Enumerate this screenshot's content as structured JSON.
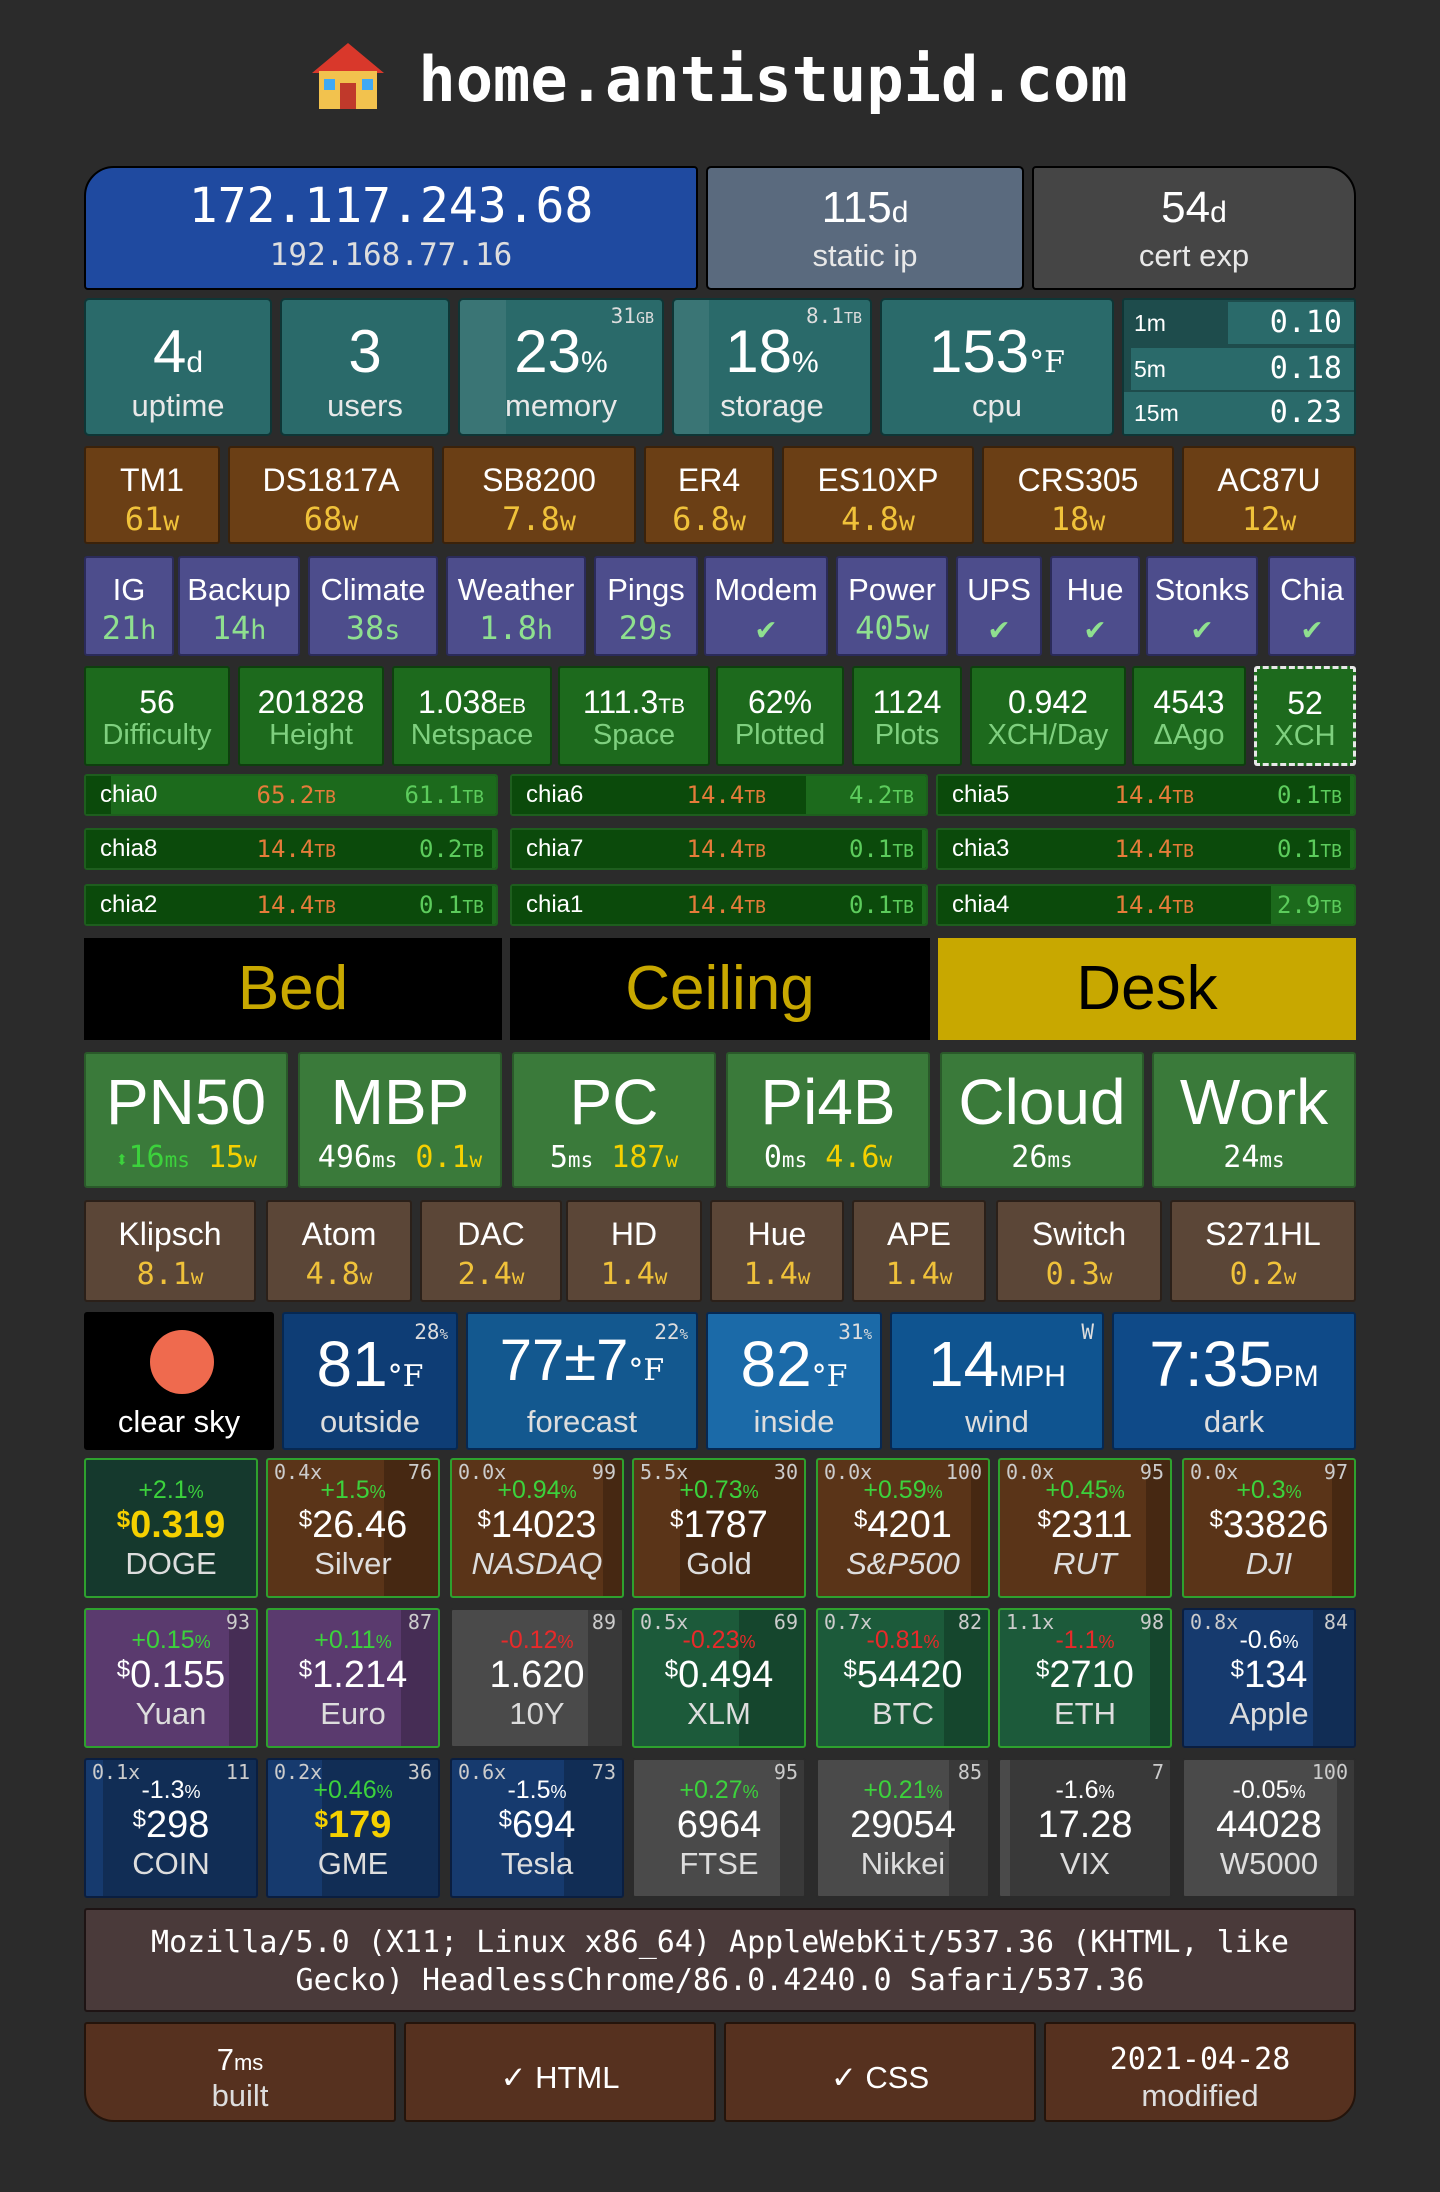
{
  "site": {
    "title": "home.antistupid.com",
    "icon": "house-icon"
  },
  "net": {
    "public_ip": "172.117.243.68",
    "local_ip": "192.168.77.16",
    "static_val": "115",
    "static_unit": "d",
    "static_lbl": "static ip",
    "cert_val": "54",
    "cert_unit": "d",
    "cert_lbl": "cert exp"
  },
  "sys": {
    "uptime_val": "4",
    "uptime_unit": "d",
    "uptime_lbl": "uptime",
    "users_val": "3",
    "users_lbl": "users",
    "mem_val": "23",
    "mem_unit": "%",
    "mem_cap": "31",
    "mem_cap_unit": "GB",
    "mem_lbl": "memory",
    "sto_val": "18",
    "sto_unit": "%",
    "sto_cap": "8.1",
    "sto_cap_unit": "TB",
    "sto_lbl": "storage",
    "cpu_val": "153",
    "cpu_unit": "°F",
    "cpu_lbl": "cpu",
    "load": [
      {
        "name": "1m",
        "value": "0.10",
        "frac": 0.55
      },
      {
        "name": "5m",
        "value": "0.18",
        "frac": 0.97
      },
      {
        "name": "15m",
        "value": "0.23",
        "frac": 1.0
      }
    ]
  },
  "devices": [
    {
      "name": "TM1",
      "val": "61",
      "unit": "w"
    },
    {
      "name": "DS1817A",
      "val": "68",
      "unit": "w"
    },
    {
      "name": "SB8200",
      "val": "7.8",
      "unit": "w"
    },
    {
      "name": "ER4",
      "val": "6.8",
      "unit": "w"
    },
    {
      "name": "ES10XP",
      "val": "4.8",
      "unit": "w"
    },
    {
      "name": "CRS305",
      "val": "18",
      "unit": "w"
    },
    {
      "name": "AC87U",
      "val": "12",
      "unit": "w"
    }
  ],
  "jobs": [
    {
      "name": "IG",
      "val": "21",
      "unit": "h"
    },
    {
      "name": "Backup",
      "val": "14",
      "unit": "h"
    },
    {
      "name": "Climate",
      "val": "38",
      "unit": "s"
    },
    {
      "name": "Weather",
      "val": "1.8",
      "unit": "h"
    },
    {
      "name": "Pings",
      "val": "29",
      "unit": "s"
    },
    {
      "name": "Modem",
      "val": "✔",
      "unit": ""
    },
    {
      "name": "Power",
      "val": "405",
      "unit": "w"
    },
    {
      "name": "UPS",
      "val": "✔",
      "unit": ""
    },
    {
      "name": "Hue",
      "val": "✔",
      "unit": ""
    },
    {
      "name": "Stonks",
      "val": "✔",
      "unit": ""
    },
    {
      "name": "Chia",
      "val": "✔",
      "unit": ""
    }
  ],
  "chia": [
    {
      "val": "56",
      "unit": "",
      "lbl": "Difficulty"
    },
    {
      "val": "201828",
      "unit": "",
      "lbl": "Height"
    },
    {
      "val": "1.038",
      "unit": "EB",
      "lbl": "Netspace"
    },
    {
      "val": "111.3",
      "unit": "TB",
      "lbl": "Space"
    },
    {
      "val": "62%",
      "unit": "",
      "lbl": "Plotted"
    },
    {
      "val": "1124",
      "unit": "",
      "lbl": "Plots"
    },
    {
      "val": "0.942",
      "unit": "",
      "lbl": "XCH/Day"
    },
    {
      "val": "4543",
      "unit": "",
      "lbl": "ΔAgo"
    },
    {
      "val": "52",
      "unit": "",
      "lbl": "XCH"
    }
  ],
  "disks": [
    {
      "name": "chia0",
      "total": "65.2",
      "tu": "TB",
      "free": "61.1",
      "fu": "TB",
      "used": 0.06
    },
    {
      "name": "chia6",
      "total": "14.4",
      "tu": "TB",
      "free": "4.2",
      "fu": "TB",
      "used": 0.71
    },
    {
      "name": "chia5",
      "total": "14.4",
      "tu": "TB",
      "free": "0.1",
      "fu": "TB",
      "used": 0.99
    },
    {
      "name": "chia8",
      "total": "14.4",
      "tu": "TB",
      "free": "0.2",
      "fu": "TB",
      "used": 0.99
    },
    {
      "name": "chia7",
      "total": "14.4",
      "tu": "TB",
      "free": "0.1",
      "fu": "TB",
      "used": 0.99
    },
    {
      "name": "chia3",
      "total": "14.4",
      "tu": "TB",
      "free": "0.1",
      "fu": "TB",
      "used": 0.99
    },
    {
      "name": "chia2",
      "total": "14.4",
      "tu": "TB",
      "free": "0.1",
      "fu": "TB",
      "used": 0.99
    },
    {
      "name": "chia1",
      "total": "14.4",
      "tu": "TB",
      "free": "0.1",
      "fu": "TB",
      "used": 0.99
    },
    {
      "name": "chia4",
      "total": "14.4",
      "tu": "TB",
      "free": "2.9",
      "fu": "TB",
      "used": 0.8
    }
  ],
  "lights": [
    {
      "name": "Bed",
      "on": false
    },
    {
      "name": "Ceiling",
      "on": false
    },
    {
      "name": "Desk",
      "on": true
    }
  ],
  "hosts": [
    {
      "name": "PN50",
      "ping": "16",
      "pu": "ms",
      "watt": "15",
      "wu": "w",
      "prefix": "⬍"
    },
    {
      "name": "MBP",
      "ping": "496",
      "pu": "ms",
      "watt": "0.1",
      "wu": "w",
      "prefix": ""
    },
    {
      "name": "PC",
      "ping": "5",
      "pu": "ms",
      "watt": "187",
      "wu": "w",
      "prefix": ""
    },
    {
      "name": "Pi4B",
      "ping": "0",
      "pu": "ms",
      "watt": "4.6",
      "wu": "w",
      "prefix": ""
    },
    {
      "name": "Cloud",
      "ping": "26",
      "pu": "ms",
      "watt": "",
      "wu": "",
      "prefix": ""
    },
    {
      "name": "Work",
      "ping": "24",
      "pu": "ms",
      "watt": "",
      "wu": "",
      "prefix": ""
    }
  ],
  "power": [
    {
      "name": "Klipsch",
      "val": "8.1",
      "unit": "w"
    },
    {
      "name": "Atom",
      "val": "4.8",
      "unit": "w"
    },
    {
      "name": "DAC",
      "val": "2.4",
      "unit": "w"
    },
    {
      "name": "HD",
      "val": "1.4",
      "unit": "w"
    },
    {
      "name": "Hue",
      "val": "1.4",
      "unit": "w"
    },
    {
      "name": "APE",
      "val": "1.4",
      "unit": "w"
    },
    {
      "name": "Switch",
      "val": "0.3",
      "unit": "w"
    },
    {
      "name": "S271HL",
      "val": "0.2",
      "unit": "w"
    }
  ],
  "weather": {
    "sky": "clear sky",
    "sky_icon": "sun-icon",
    "outside_val": "81",
    "outside_unit": "°F",
    "outside_lbl": "outside",
    "outside_cap": "28",
    "fc_val": "77±7",
    "fc_unit": "°F",
    "fc_lbl": "forecast",
    "fc_cap": "22",
    "in_val": "82",
    "in_unit": "°F",
    "in_lbl": "inside",
    "in_cap": "31",
    "wind_val": "14",
    "wind_unit": "MPH",
    "wind_lbl": "wind",
    "wind_cap": "W",
    "time_val": "7:35",
    "time_unit": "PM",
    "time_lbl": "dark",
    "pct": "%"
  },
  "stocks": [
    [
      {
        "tl": "",
        "tr": "",
        "chg": "+2.1",
        "price": "0.319",
        "cur": "$",
        "name": "DOGE",
        "bg": "#1c4a3a",
        "hl": true,
        "pos": true,
        "it": false
      },
      {
        "tl": "0.4x",
        "tr": "76",
        "chg": "+1.5",
        "price": "26.46",
        "cur": "$",
        "name": "Silver",
        "bg": "#5a3418",
        "hl": false,
        "pos": true,
        "it": false
      },
      {
        "tl": "0.0x",
        "tr": "99",
        "chg": "+0.94",
        "price": "14023",
        "cur": "$",
        "name": "NASDAQ",
        "bg": "#5a3418",
        "hl": false,
        "pos": true,
        "it": true
      },
      {
        "tl": "5.5x",
        "tr": "30",
        "chg": "+0.73",
        "price": "1787",
        "cur": "$",
        "name": "Gold",
        "bg": "#5a3418",
        "hl": false,
        "pos": true,
        "it": false
      },
      {
        "tl": "0.0x",
        "tr": "100",
        "chg": "+0.59",
        "price": "4201",
        "cur": "$",
        "name": "S&P500",
        "bg": "#5a3418",
        "hl": false,
        "pos": true,
        "it": true
      },
      {
        "tl": "0.0x",
        "tr": "95",
        "chg": "+0.45",
        "price": "2311",
        "cur": "$",
        "name": "RUT",
        "bg": "#5a3418",
        "hl": false,
        "pos": true,
        "it": true
      },
      {
        "tl": "0.0x",
        "tr": "97",
        "chg": "+0.3",
        "price": "33826",
        "cur": "$",
        "name": "DJI",
        "bg": "#5a3418",
        "hl": false,
        "pos": true,
        "it": true
      }
    ],
    [
      {
        "tl": "",
        "tr": "93",
        "chg": "+0.15",
        "price": "0.155",
        "cur": "$",
        "name": "Yuan",
        "bg": "#5a3a6e",
        "hl": false,
        "pos": true,
        "it": false
      },
      {
        "tl": "",
        "tr": "87",
        "chg": "+0.11",
        "price": "1.214",
        "cur": "$",
        "name": "Euro",
        "bg": "#5a3a6e",
        "hl": false,
        "pos": true,
        "it": false
      },
      {
        "tl": "",
        "tr": "89",
        "chg": "-0.12",
        "price": "1.620",
        "cur": "",
        "name": "10Y",
        "bg": "#4a4a4a",
        "hl": false,
        "pos": false,
        "it": false
      },
      {
        "tl": "0.5x",
        "tr": "69",
        "chg": "-0.23",
        "price": "0.494",
        "cur": "$",
        "name": "XLM",
        "bg": "#1c5a3a",
        "hl": false,
        "pos": false,
        "it": false
      },
      {
        "tl": "0.7x",
        "tr": "82",
        "chg": "-0.81",
        "price": "54420",
        "cur": "$",
        "name": "BTC",
        "bg": "#1c5a3a",
        "hl": false,
        "pos": false,
        "it": false
      },
      {
        "tl": "1.1x",
        "tr": "98",
        "chg": "-1.1",
        "price": "2710",
        "cur": "$",
        "name": "ETH",
        "bg": "#1c5a3a",
        "hl": false,
        "pos": false,
        "it": false
      },
      {
        "tl": "0.8x",
        "tr": "84",
        "chg": "-0.6",
        "price": "134",
        "cur": "$",
        "name": "Apple",
        "bg": "#163a6e",
        "hl": false,
        "pos": false,
        "it": false
      }
    ],
    [
      {
        "tl": "0.1x",
        "tr": "11",
        "chg": "-1.3",
        "price": "298",
        "cur": "$",
        "name": "COIN",
        "bg": "#163a6e",
        "hl": false,
        "pos": false,
        "it": false
      },
      {
        "tl": "0.2x",
        "tr": "36",
        "chg": "+0.46",
        "price": "179",
        "cur": "$",
        "name": "GME",
        "bg": "#163a6e",
        "hl": true,
        "pos": true,
        "it": false
      },
      {
        "tl": "0.6x",
        "tr": "73",
        "chg": "-1.5",
        "price": "694",
        "cur": "$",
        "name": "Tesla",
        "bg": "#163a6e",
        "hl": false,
        "pos": false,
        "it": false
      },
      {
        "tl": "",
        "tr": "95",
        "chg": "+0.27",
        "price": "6964",
        "cur": "",
        "name": "FTSE",
        "bg": "#4a4a4a",
        "hl": false,
        "pos": true,
        "it": false
      },
      {
        "tl": "",
        "tr": "85",
        "chg": "+0.21",
        "price": "29054",
        "cur": "",
        "name": "Nikkei",
        "bg": "#4a4a4a",
        "hl": false,
        "pos": true,
        "it": false
      },
      {
        "tl": "",
        "tr": "7",
        "chg": "-1.6",
        "price": "17.28",
        "cur": "",
        "name": "VIX",
        "bg": "#4a4a4a",
        "hl": false,
        "pos": false,
        "it": false
      },
      {
        "tl": "",
        "tr": "100",
        "chg": "-0.05",
        "price": "44028",
        "cur": "",
        "name": "W5000",
        "bg": "#4a4a4a",
        "hl": false,
        "pos": false,
        "it": false
      }
    ]
  ],
  "ua": "Mozilla/5.0 (X11; Linux x86_64) AppleWebKit/537.36 (KHTML, like Gecko) HeadlessChrome/86.0.4240.0 Safari/537.36",
  "footer": {
    "built_val": "7",
    "built_unit": "ms",
    "built_lbl": "built",
    "html": "✓ HTML",
    "css": "✓ CSS",
    "mod_val": "2021-04-28",
    "mod_lbl": "modified"
  },
  "colors": {
    "accent": "#f0c23a",
    "bg": "#2b2b2b",
    "ip": "#1f4aa0"
  }
}
